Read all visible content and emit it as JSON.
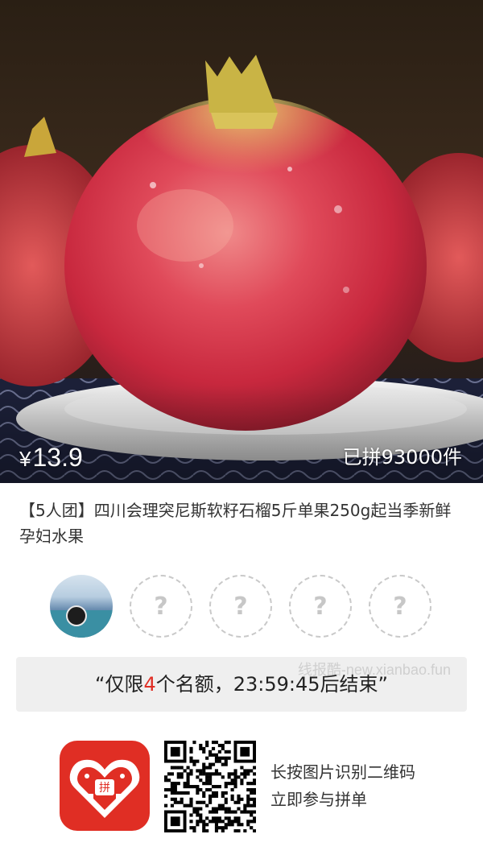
{
  "product": {
    "price_symbol": "¥",
    "price": "13.9",
    "sold": "已拼93000件",
    "title": "【5人团】四川会理突尼斯软籽石榴5斤单果250g起当季新鲜孕妇水果"
  },
  "group": {
    "open_slots": [
      "?",
      "?",
      "?",
      "?"
    ]
  },
  "quota": {
    "prefix": "“仅限",
    "count": "4",
    "suffix": "个名额，23:59:45后结束”",
    "watermark": "线报酷-new.xianbao.fun"
  },
  "footer": {
    "line1": "长按图片识别二维码",
    "line2": "立即参与拼单"
  },
  "colors": {
    "accent": "#e02e24",
    "quota_bg": "#efefef"
  },
  "icons": {
    "app": "pinduoduo-app-icon",
    "qr": "qr-code"
  }
}
